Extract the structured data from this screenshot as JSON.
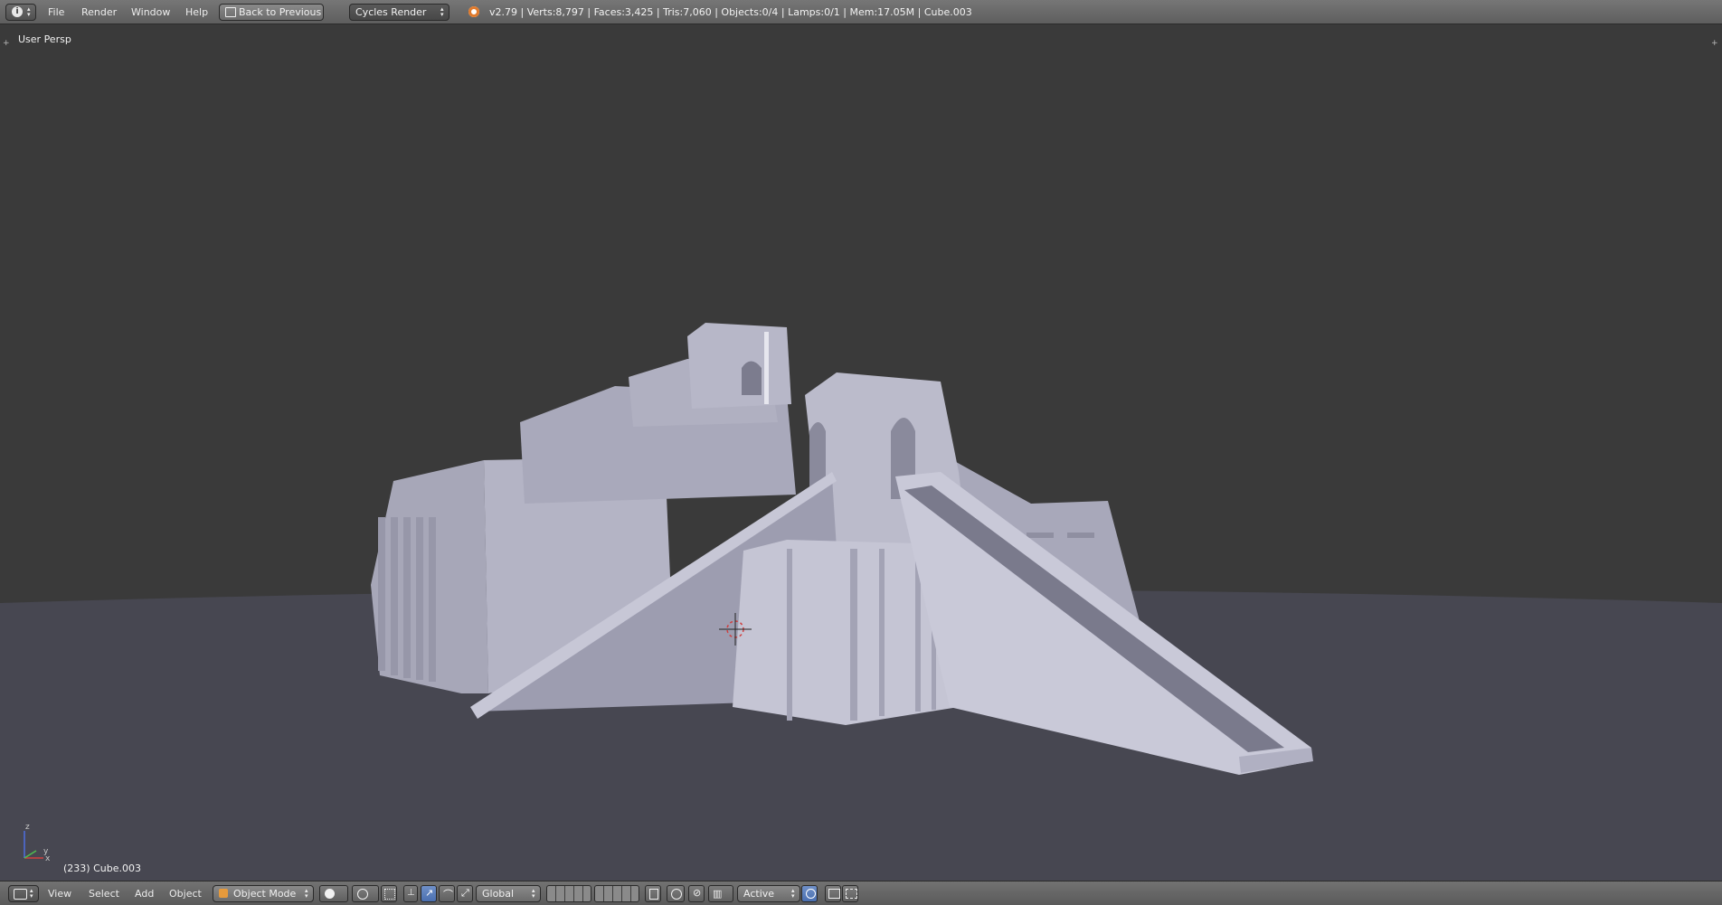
{
  "top_menu": {
    "items": [
      "File",
      "Render",
      "Window",
      "Help"
    ],
    "back_button": "Back to Previous",
    "render_engine": "Cycles Render",
    "stats": "v2.79 | Verts:8,797 | Faces:3,425 | Tris:7,060 | Objects:0/4 | Lamps:0/1 | Mem:17.05M | Cube.003"
  },
  "viewport": {
    "view_label": "User Persp",
    "object_label": "(233) Cube.003",
    "axis_labels": [
      "z",
      "x",
      "y"
    ]
  },
  "bottom_menu": {
    "items": [
      "View",
      "Select",
      "Add",
      "Object"
    ],
    "mode": "Object Mode",
    "orientation": "Global",
    "pivot": "Active"
  },
  "colors": {
    "header_bg": "#6a6a6a",
    "viewport_bg": "#3a3a3a",
    "ground": "#4a4a55",
    "model": "#b9b9c9",
    "accent_blue": "#4a6fb0"
  }
}
